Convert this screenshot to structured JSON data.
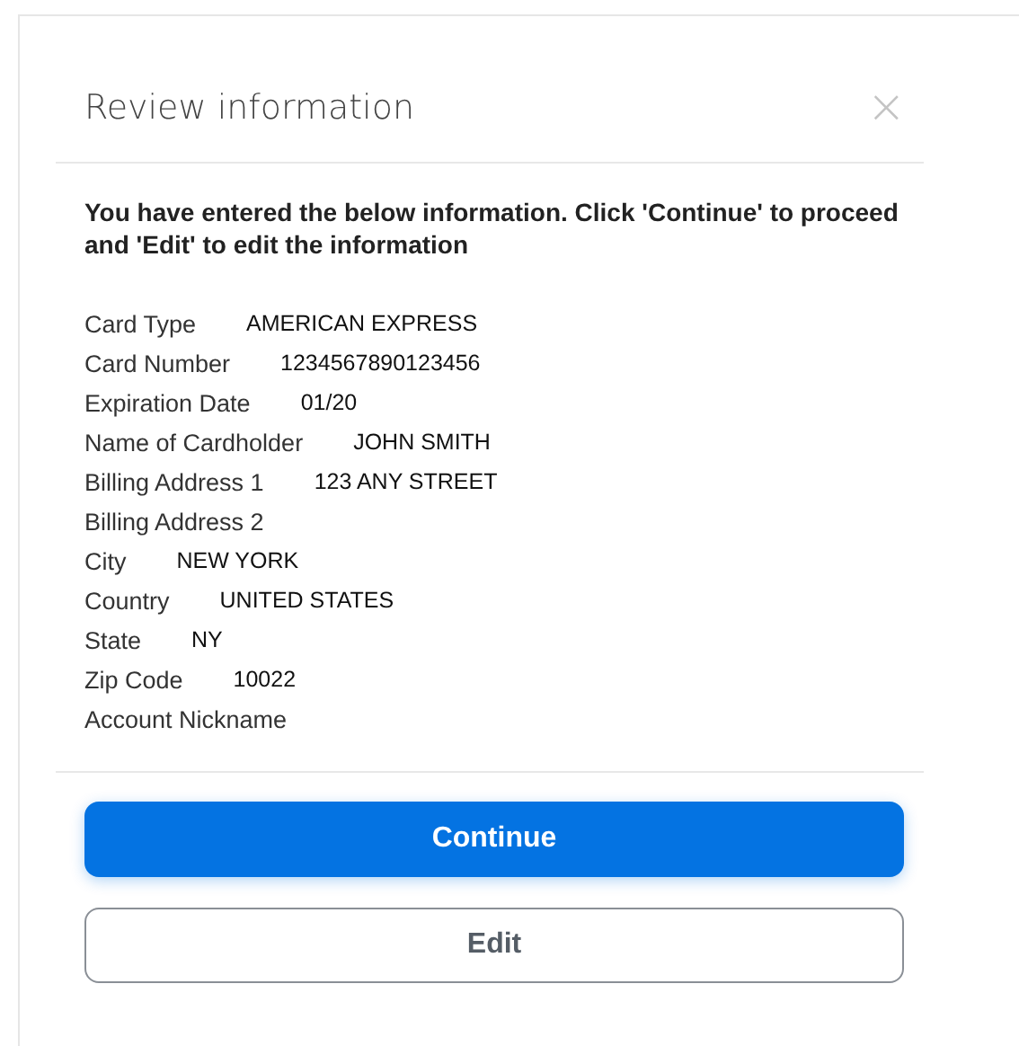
{
  "dialog": {
    "title": "Review information",
    "close": "×",
    "message": "You have entered the below information. Click 'Continue' to proceed and 'Edit' to edit the information",
    "fields": [
      {
        "label": "Card Type",
        "value": "AMERICAN EXPRESS"
      },
      {
        "label": "Card Number",
        "value": "1234567890123456"
      },
      {
        "label": "Expiration Date",
        "value": "01/20"
      },
      {
        "label": "Name of Cardholder",
        "value": "JOHN SMITH"
      },
      {
        "label": "Billing Address 1",
        "value": "123 ANY STREET"
      },
      {
        "label": "Billing Address 2"
      },
      {
        "label": "City",
        "value": "NEW YORK"
      },
      {
        "label": "Country",
        "value": "UNITED STATES"
      },
      {
        "label": "State",
        "value": "NY"
      },
      {
        "label": "Zip Code",
        "value": "10022"
      },
      {
        "label": "Account Nickname"
      }
    ],
    "buttons": [
      {
        "label": "Continue",
        "kind": "primary"
      },
      {
        "label": "Edit",
        "kind": "secondary"
      }
    ]
  }
}
